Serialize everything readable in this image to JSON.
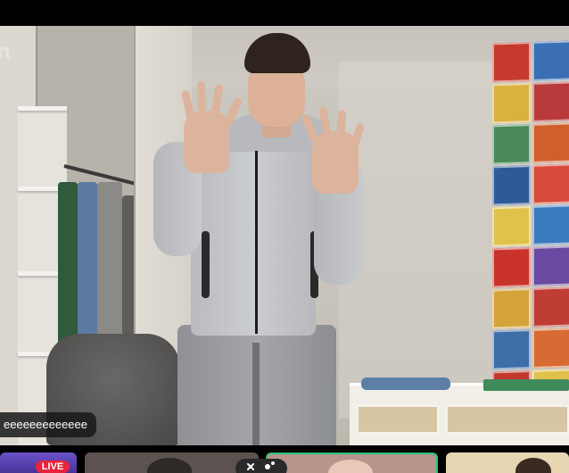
{
  "app": {
    "watermark_text": "n"
  },
  "chat": {
    "message_text": "eeeeeeeeeeeee"
  },
  "thumbnails": {
    "items": [
      {
        "id": "thumb-1",
        "badge_text": "LIVE",
        "accent": "#5a3fb0"
      },
      {
        "id": "thumb-2",
        "accent": "#5c5350"
      },
      {
        "id": "thumb-3",
        "accent": "#b8948a",
        "active": true
      },
      {
        "id": "thumb-4",
        "accent": "#e8d6b3"
      }
    ]
  },
  "colors": {
    "live_badge": "#e8243c",
    "active_border": "#28c27a",
    "bubble_bg": "#191919"
  },
  "icons": {
    "action_button": "sparkle-icon"
  }
}
